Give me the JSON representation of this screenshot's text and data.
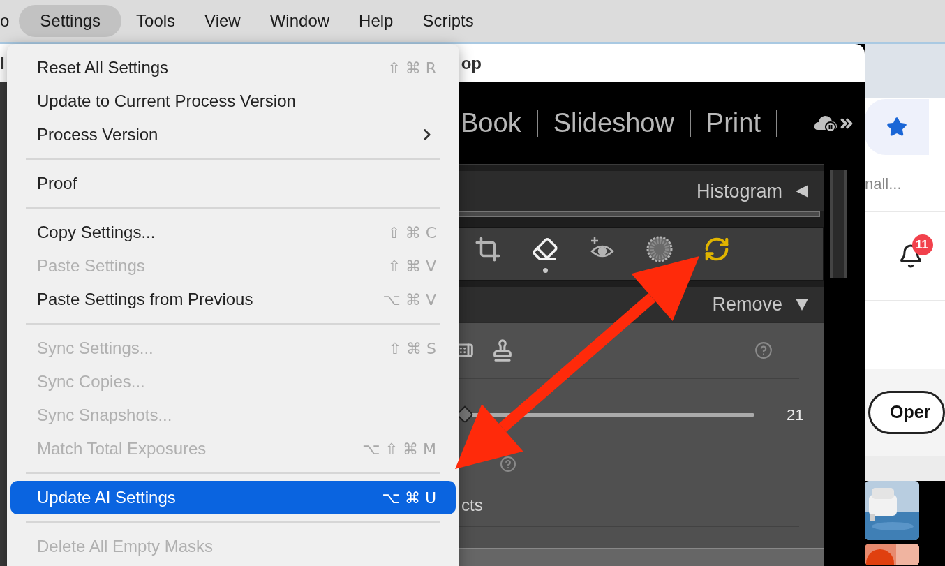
{
  "menu_bar": {
    "items": [
      {
        "label": "o",
        "selected": false
      },
      {
        "label": "Settings",
        "selected": true
      },
      {
        "label": "Tools",
        "selected": false
      },
      {
        "label": "View",
        "selected": false
      },
      {
        "label": "Window",
        "selected": false
      },
      {
        "label": "Help",
        "selected": false
      },
      {
        "label": "Scripts",
        "selected": false
      }
    ]
  },
  "browser_window": {
    "title_start": "I",
    "title_end": "op"
  },
  "lightroom": {
    "modules": [
      "Book",
      "Slideshow",
      "Print"
    ],
    "histogram": {
      "title": "Histogram",
      "expanded": false
    },
    "tools": [
      {
        "kind": "crop",
        "selected": false,
        "alert": false
      },
      {
        "kind": "eraser",
        "selected": true,
        "alert": false
      },
      {
        "kind": "red_eye",
        "selected": false,
        "alert": false
      },
      {
        "kind": "masking",
        "selected": false,
        "alert": false
      },
      {
        "kind": "ai_update",
        "selected": false,
        "alert": true
      }
    ],
    "remove": {
      "title": "Remove",
      "expanded": true,
      "slider": {
        "level": 0.04,
        "value": "21"
      },
      "partial_label": "cts"
    }
  },
  "dropdown": {
    "items": [
      {
        "kind": "item",
        "label": "Reset All Settings",
        "shortcut": "⇧ ⌘ R",
        "disabled": false,
        "selected": false,
        "submenu": false
      },
      {
        "kind": "item",
        "label": "Update to Current Process Version",
        "disabled": false,
        "selected": false,
        "submenu": false
      },
      {
        "kind": "item",
        "label": "Process Version",
        "disabled": false,
        "selected": false,
        "submenu": true
      },
      {
        "kind": "separator"
      },
      {
        "kind": "item",
        "label": "Proof",
        "disabled": false,
        "selected": false,
        "submenu": false
      },
      {
        "kind": "separator"
      },
      {
        "kind": "item",
        "label": "Copy Settings...",
        "shortcut": "⇧ ⌘ C",
        "disabled": false,
        "selected": false,
        "submenu": false
      },
      {
        "kind": "item",
        "label": "Paste Settings",
        "shortcut": "⇧ ⌘ V",
        "disabled": true,
        "selected": false,
        "submenu": false
      },
      {
        "kind": "item",
        "label": "Paste Settings from Previous",
        "shortcut": "⌥ ⌘ V",
        "disabled": false,
        "selected": false,
        "submenu": false
      },
      {
        "kind": "separator"
      },
      {
        "kind": "item",
        "label": "Sync Settings...",
        "shortcut": "⇧ ⌘ S",
        "disabled": true,
        "selected": false,
        "submenu": false
      },
      {
        "kind": "item",
        "label": "Sync Copies...",
        "disabled": true,
        "selected": false,
        "submenu": false
      },
      {
        "kind": "item",
        "label": "Sync Snapshots...",
        "disabled": true,
        "selected": false,
        "submenu": false
      },
      {
        "kind": "item",
        "label": "Match Total Exposures",
        "shortcut": "⌥ ⇧ ⌘ M",
        "disabled": true,
        "selected": false,
        "submenu": false
      },
      {
        "kind": "separator"
      },
      {
        "kind": "item",
        "label": "Update AI Settings",
        "shortcut": "⌥ ⌘ U",
        "disabled": false,
        "selected": true,
        "submenu": false
      },
      {
        "kind": "separator"
      },
      {
        "kind": "item",
        "label": "Delete All Empty Masks",
        "disabled": true,
        "selected": false,
        "submenu": false
      }
    ]
  },
  "browser_side": {
    "truncated_text": "nall...",
    "notification_count": "11",
    "button": "Oper"
  }
}
